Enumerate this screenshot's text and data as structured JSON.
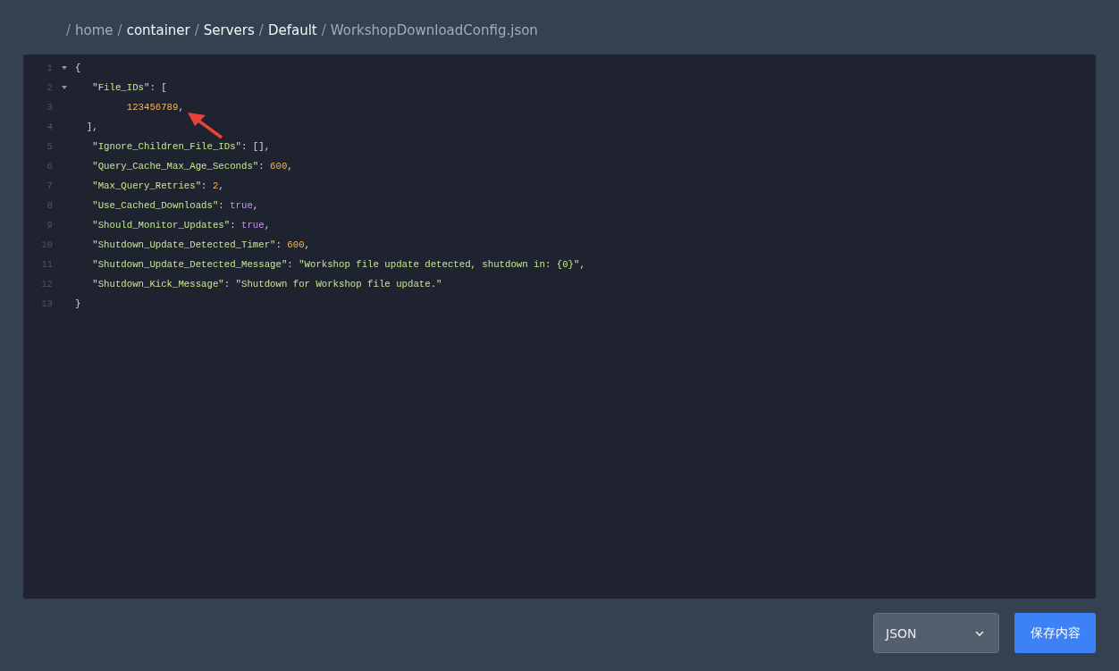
{
  "breadcrumb": [
    {
      "separator": "/",
      "label": "home",
      "kind": "muted"
    },
    {
      "separator": "/",
      "label": "container",
      "kind": "link"
    },
    {
      "separator": "/",
      "label": "Servers",
      "kind": "link"
    },
    {
      "separator": "/",
      "label": "Default",
      "kind": "link"
    },
    {
      "separator": "/",
      "label": "WorkshopDownloadConfig.json",
      "kind": "muted"
    }
  ],
  "editor": {
    "lines": [
      {
        "number": "1",
        "foldable": true,
        "tokens": [
          {
            "kind": "punct",
            "text": "{"
          }
        ]
      },
      {
        "number": "2",
        "foldable": true,
        "tokens": [
          {
            "kind": "key",
            "text": "   \"File_IDs\""
          },
          {
            "kind": "punct",
            "text": ": ["
          }
        ]
      },
      {
        "number": "3",
        "foldable": false,
        "tokens": [
          {
            "kind": "number",
            "text": "         123456789"
          },
          {
            "kind": "punct",
            "text": ","
          }
        ]
      },
      {
        "number": "4",
        "foldable": false,
        "tokens": [
          {
            "kind": "punct",
            "text": "  ],"
          }
        ]
      },
      {
        "number": "5",
        "foldable": false,
        "tokens": [
          {
            "kind": "key",
            "text": "   \"Ignore_Children_File_IDs\""
          },
          {
            "kind": "punct",
            "text": ": [],"
          }
        ]
      },
      {
        "number": "6",
        "foldable": false,
        "tokens": [
          {
            "kind": "key",
            "text": "   \"Query_Cache_Max_Age_Seconds\""
          },
          {
            "kind": "punct",
            "text": ": "
          },
          {
            "kind": "number",
            "text": "600"
          },
          {
            "kind": "punct",
            "text": ","
          }
        ]
      },
      {
        "number": "7",
        "foldable": false,
        "tokens": [
          {
            "kind": "key",
            "text": "   \"Max_Query_Retries\""
          },
          {
            "kind": "punct",
            "text": ": "
          },
          {
            "kind": "number",
            "text": "2"
          },
          {
            "kind": "punct",
            "text": ","
          }
        ]
      },
      {
        "number": "8",
        "foldable": false,
        "tokens": [
          {
            "kind": "key",
            "text": "   \"Use_Cached_Downloads\""
          },
          {
            "kind": "punct",
            "text": ": "
          },
          {
            "kind": "bool",
            "text": "true"
          },
          {
            "kind": "punct",
            "text": ","
          }
        ]
      },
      {
        "number": "9",
        "foldable": false,
        "tokens": [
          {
            "kind": "key",
            "text": "   \"Should_Monitor_Updates\""
          },
          {
            "kind": "punct",
            "text": ": "
          },
          {
            "kind": "bool",
            "text": "true"
          },
          {
            "kind": "punct",
            "text": ","
          }
        ]
      },
      {
        "number": "10",
        "foldable": false,
        "tokens": [
          {
            "kind": "key",
            "text": "   \"Shutdown_Update_Detected_Timer\""
          },
          {
            "kind": "punct",
            "text": ": "
          },
          {
            "kind": "number",
            "text": "600"
          },
          {
            "kind": "punct",
            "text": ","
          }
        ]
      },
      {
        "number": "11",
        "foldable": false,
        "tokens": [
          {
            "kind": "key",
            "text": "   \"Shutdown_Update_Detected_Message\""
          },
          {
            "kind": "punct",
            "text": ": "
          },
          {
            "kind": "string",
            "text": "\"Workshop file update detected, shutdown in: {0}\""
          },
          {
            "kind": "punct",
            "text": ","
          }
        ]
      },
      {
        "number": "12",
        "foldable": false,
        "tokens": [
          {
            "kind": "key",
            "text": "   \"Shutdown_Kick_Message\""
          },
          {
            "kind": "punct",
            "text": ": "
          },
          {
            "kind": "string",
            "text": "\"Shutdown for Workshop file update.\""
          }
        ]
      },
      {
        "number": "13",
        "foldable": false,
        "tokens": [
          {
            "kind": "punct",
            "text": "}"
          }
        ]
      }
    ]
  },
  "footer": {
    "format_select": "JSON",
    "save_button": "保存内容"
  }
}
